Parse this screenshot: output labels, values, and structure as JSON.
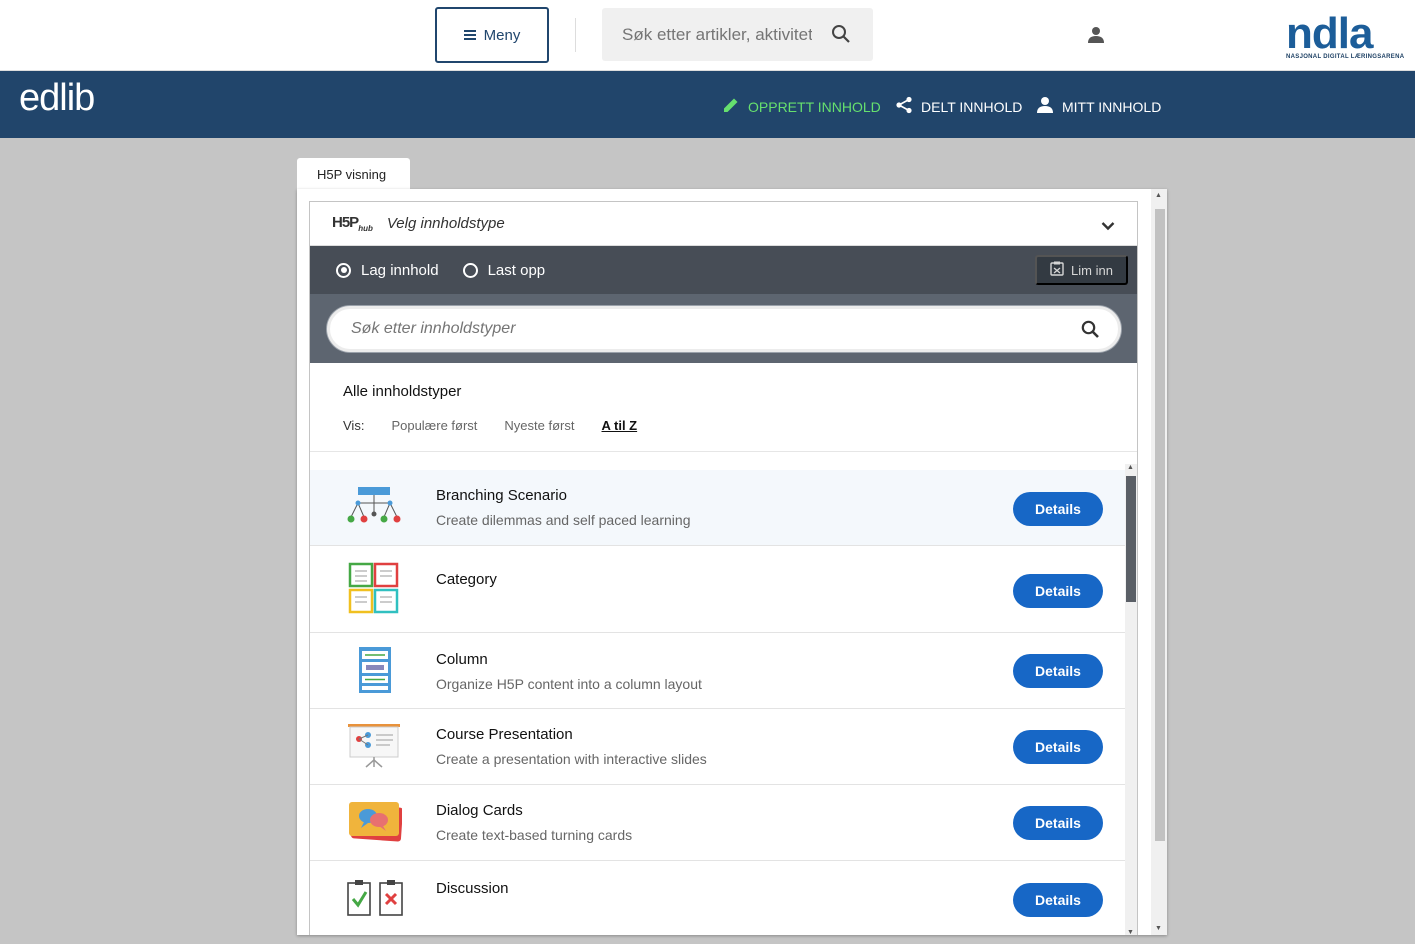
{
  "topbar": {
    "menu_label": "Meny",
    "search_placeholder": "Søk etter artikler, aktiviteter",
    "logo_text": "ndla",
    "logo_subtitle": "NASJONAL DIGITAL LÆRINGSARENA"
  },
  "edlib": {
    "logo_text": "edlib",
    "nav": {
      "create": "OPPRETT INNHOLD",
      "shared": "DELT INNHOLD",
      "mine": "MITT INNHOLD"
    },
    "colors": {
      "bar": "#21456b",
      "create_accent": "#66e06e"
    }
  },
  "tab_label": "H5P visning",
  "hub": {
    "logo": "H5P",
    "logo_sub": "hub",
    "title": "Velg innholdstype",
    "radio_create": "Lag innhold",
    "radio_upload": "Last opp",
    "paste_label": "Lim inn",
    "search_placeholder": "Søk etter innholdstyper",
    "all_types": "Alle innholdstyper",
    "sort_label": "Vis:",
    "sort_popular": "Populære først",
    "sort_newest": "Nyeste først",
    "sort_az": "A til Z",
    "details_label": "Details",
    "items": [
      {
        "name": "Branching Scenario",
        "desc": "Create dilemmas and self paced learning",
        "icon": "branching-scenario-icon"
      },
      {
        "name": "Category",
        "desc": "",
        "icon": "category-icon"
      },
      {
        "name": "Column",
        "desc": "Organize H5P content into a column layout",
        "icon": "column-icon"
      },
      {
        "name": "Course Presentation",
        "desc": "Create a presentation with interactive slides",
        "icon": "course-presentation-icon"
      },
      {
        "name": "Dialog Cards",
        "desc": "Create text-based turning cards",
        "icon": "dialog-cards-icon"
      },
      {
        "name": "Discussion",
        "desc": "",
        "icon": "discussion-icon"
      }
    ]
  }
}
